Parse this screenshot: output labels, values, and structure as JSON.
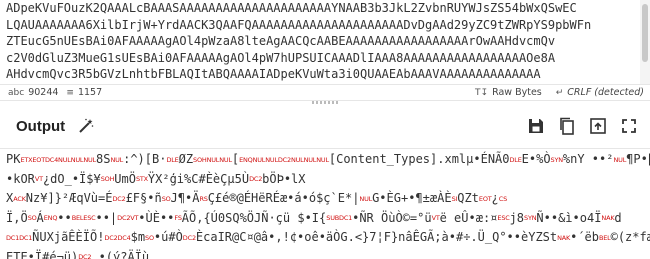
{
  "input": {
    "lines": [
      "ADpeKVuFOuzK2QAAALcBAAASAAAAAAAAAAAAAAAAAAAAAYNAAB3b3JkL2ZvbnRUYWJsZS54bWxQSwEC",
      "LQAUAAAAAAA6XilbIrjW+YrdAACK3QAAFQAAAAAAAAAAAAAAAAAAAAADvDgAAd29yZC9tZWRpYS9pbWFn",
      "ZTEucG5nUEsBAi0AFAAAAAgAOl4pWzaA8lteAgAACQcAABEAAAAAAAAAAAAAAAAArOwAAHdvcmQv",
      "c2V0dGluZ3MueG1sUEsBAi0AFAAAAAgAOl4pW7hUPSUICAAADlIAAA8AAAAAAAAAAAAAAAAAOe8A",
      "AHdvcmQvc3R5bGVzLnhtbFBLAQItABQAAAAIADpeKVuWta3i0QUAAEAbAAAVAAAAAAAAAAAAAA"
    ]
  },
  "status_bar": {
    "length_icon": "abc",
    "length_value": "90244",
    "lines_icon": "≡",
    "lines_value": "1157",
    "encoding_icon": "T↧",
    "encoding_label": "Raw Bytes",
    "eol_icon": "↵",
    "eol_label": "CRLF (detected)"
  },
  "output": {
    "title": "Output",
    "lines": [
      [
        {
          "t": "text",
          "v": "PK"
        },
        {
          "t": "ctl",
          "v": "ETXEOTDC4NULNULNUL"
        },
        {
          "t": "text",
          "v": "8S"
        },
        {
          "t": "ctl",
          "v": "NUL"
        },
        {
          "t": "text",
          "v": ":^)[B·"
        },
        {
          "t": "ctl",
          "v": "DLE"
        },
        {
          "t": "text",
          "v": "ØZ"
        },
        {
          "t": "ctl",
          "v": "SOHNULNUL"
        },
        {
          "t": "text",
          "v": "["
        },
        {
          "t": "ctl",
          "v": "ENQNULNULDC2NULNULNUL"
        },
        {
          "t": "text",
          "v": "[Content_Types].xmlµ•ÉNÃ0"
        },
        {
          "t": "ctl",
          "v": "DLE"
        },
        {
          "t": "text",
          "v": "E•%Ò"
        },
        {
          "t": "ctl",
          "v": "SYN"
        },
        {
          "t": "text",
          "v": "%nY ••²"
        },
        {
          "t": "ctl",
          "v": "NUL"
        },
        {
          "t": "text",
          "v": "¶P•þ"
        }
      ],
      [
        {
          "t": "text",
          "v": "•kOR"
        },
        {
          "t": "ctl",
          "v": "VT"
        },
        {
          "t": "text",
          "v": "¿dO_•Ï$¥"
        },
        {
          "t": "ctl",
          "v": "SOH"
        },
        {
          "t": "text",
          "v": "UmÖ"
        },
        {
          "t": "ctl",
          "v": "STX"
        },
        {
          "t": "text",
          "v": "ŸX²ģi%C#ÈèÇµ5Ù"
        },
        {
          "t": "ctl",
          "v": "DC2"
        },
        {
          "t": "text",
          "v": "bÖÞ•lX"
        }
      ],
      [
        {
          "t": "text",
          "v": "X"
        },
        {
          "t": "ctl",
          "v": "ACK"
        },
        {
          "t": "text",
          "v": "Nz¥]}²ÆqVù=É"
        },
        {
          "t": "ctl",
          "v": "DC2"
        },
        {
          "t": "text",
          "v": "£F§•ñ"
        },
        {
          "t": "ctl",
          "v": "SO"
        },
        {
          "t": "text",
          "v": "J¶•Ä"
        },
        {
          "t": "ctl",
          "v": "RS"
        },
        {
          "t": "text",
          "v": "Ç£é®@ÉHëRÉæ•á•ó$ç`E*|"
        },
        {
          "t": "ctl",
          "v": "NUL"
        },
        {
          "t": "text",
          "v": "G•ÈG+•¶±æÀÈ"
        },
        {
          "t": "ctl",
          "v": "SI"
        },
        {
          "t": "text",
          "v": "QZt"
        },
        {
          "t": "ctl",
          "v": "EOT"
        },
        {
          "t": "text",
          "v": "¿"
        },
        {
          "t": "ctl",
          "v": "CS"
        }
      ],
      [
        {
          "t": "text",
          "v": "Ï,Ö"
        },
        {
          "t": "ctl",
          "v": "SO"
        },
        {
          "t": "text",
          "v": "Á"
        },
        {
          "t": "ctl",
          "v": "ENQ"
        },
        {
          "t": "text",
          "v": "••"
        },
        {
          "t": "ctl",
          "v": "BELESC"
        },
        {
          "t": "text",
          "v": "••|"
        },
        {
          "t": "ctl",
          "v": "DC2VT"
        },
        {
          "t": "text",
          "v": "•ÙÈ••"
        },
        {
          "t": "ctl",
          "v": "FS"
        },
        {
          "t": "text",
          "v": "ÃÕ,{Ú0SQ%ÖJÑ·çü $•I{"
        },
        {
          "t": "ctl",
          "v": "SUBDC1"
        },
        {
          "t": "text",
          "v": "•ÑR ÖùÒ©=°ü"
        },
        {
          "t": "ctl",
          "v": "VT"
        },
        {
          "t": "text",
          "v": "ë eÛ•æ:¤"
        },
        {
          "t": "ctl",
          "v": "ESC"
        },
        {
          "t": "text",
          "v": "j8"
        },
        {
          "t": "ctl",
          "v": "SYN"
        },
        {
          "t": "text",
          "v": "Ñ••&ì•o4Ï"
        },
        {
          "t": "ctl",
          "v": "NAK"
        },
        {
          "t": "text",
          "v": "d"
        }
      ],
      [
        {
          "t": "ctl",
          "v": "DC1DC1"
        },
        {
          "t": "text",
          "v": "ÑUXjãÊÈÏÕ!"
        },
        {
          "t": "ctl",
          "v": "DC2DC4"
        },
        {
          "t": "text",
          "v": "$m"
        },
        {
          "t": "ctl",
          "v": "SO"
        },
        {
          "t": "text",
          "v": "•ú#Ò"
        },
        {
          "t": "ctl",
          "v": "DC2"
        },
        {
          "t": "text",
          "v": "ÈcaIR@C¤@â•,!¢•oê•äÒG.<}7¦F}nâÊGÃ;à•#÷.Ü_Q°••èYZSt"
        },
        {
          "t": "ctl",
          "v": "NAK"
        },
        {
          "t": "text",
          "v": "•´ëb"
        },
        {
          "t": "ctl",
          "v": "BEL"
        },
        {
          "t": "text",
          "v": "©(z*fæ"
        }
      ],
      [
        {
          "t": "text",
          "v": "ETE•Ï#é¬ü)"
        },
        {
          "t": "ctl",
          "v": "DC2"
        },
        {
          "t": "text",
          "v": " •(ý?ÄÏù"
        }
      ]
    ]
  },
  "colors": {
    "control_char": "#d11111",
    "text": "#333333",
    "toolbar_icon": "#333333"
  },
  "icons": [
    "magic-wand-icon",
    "save-icon",
    "copy-icon",
    "upload-icon",
    "fullscreen-icon"
  ]
}
